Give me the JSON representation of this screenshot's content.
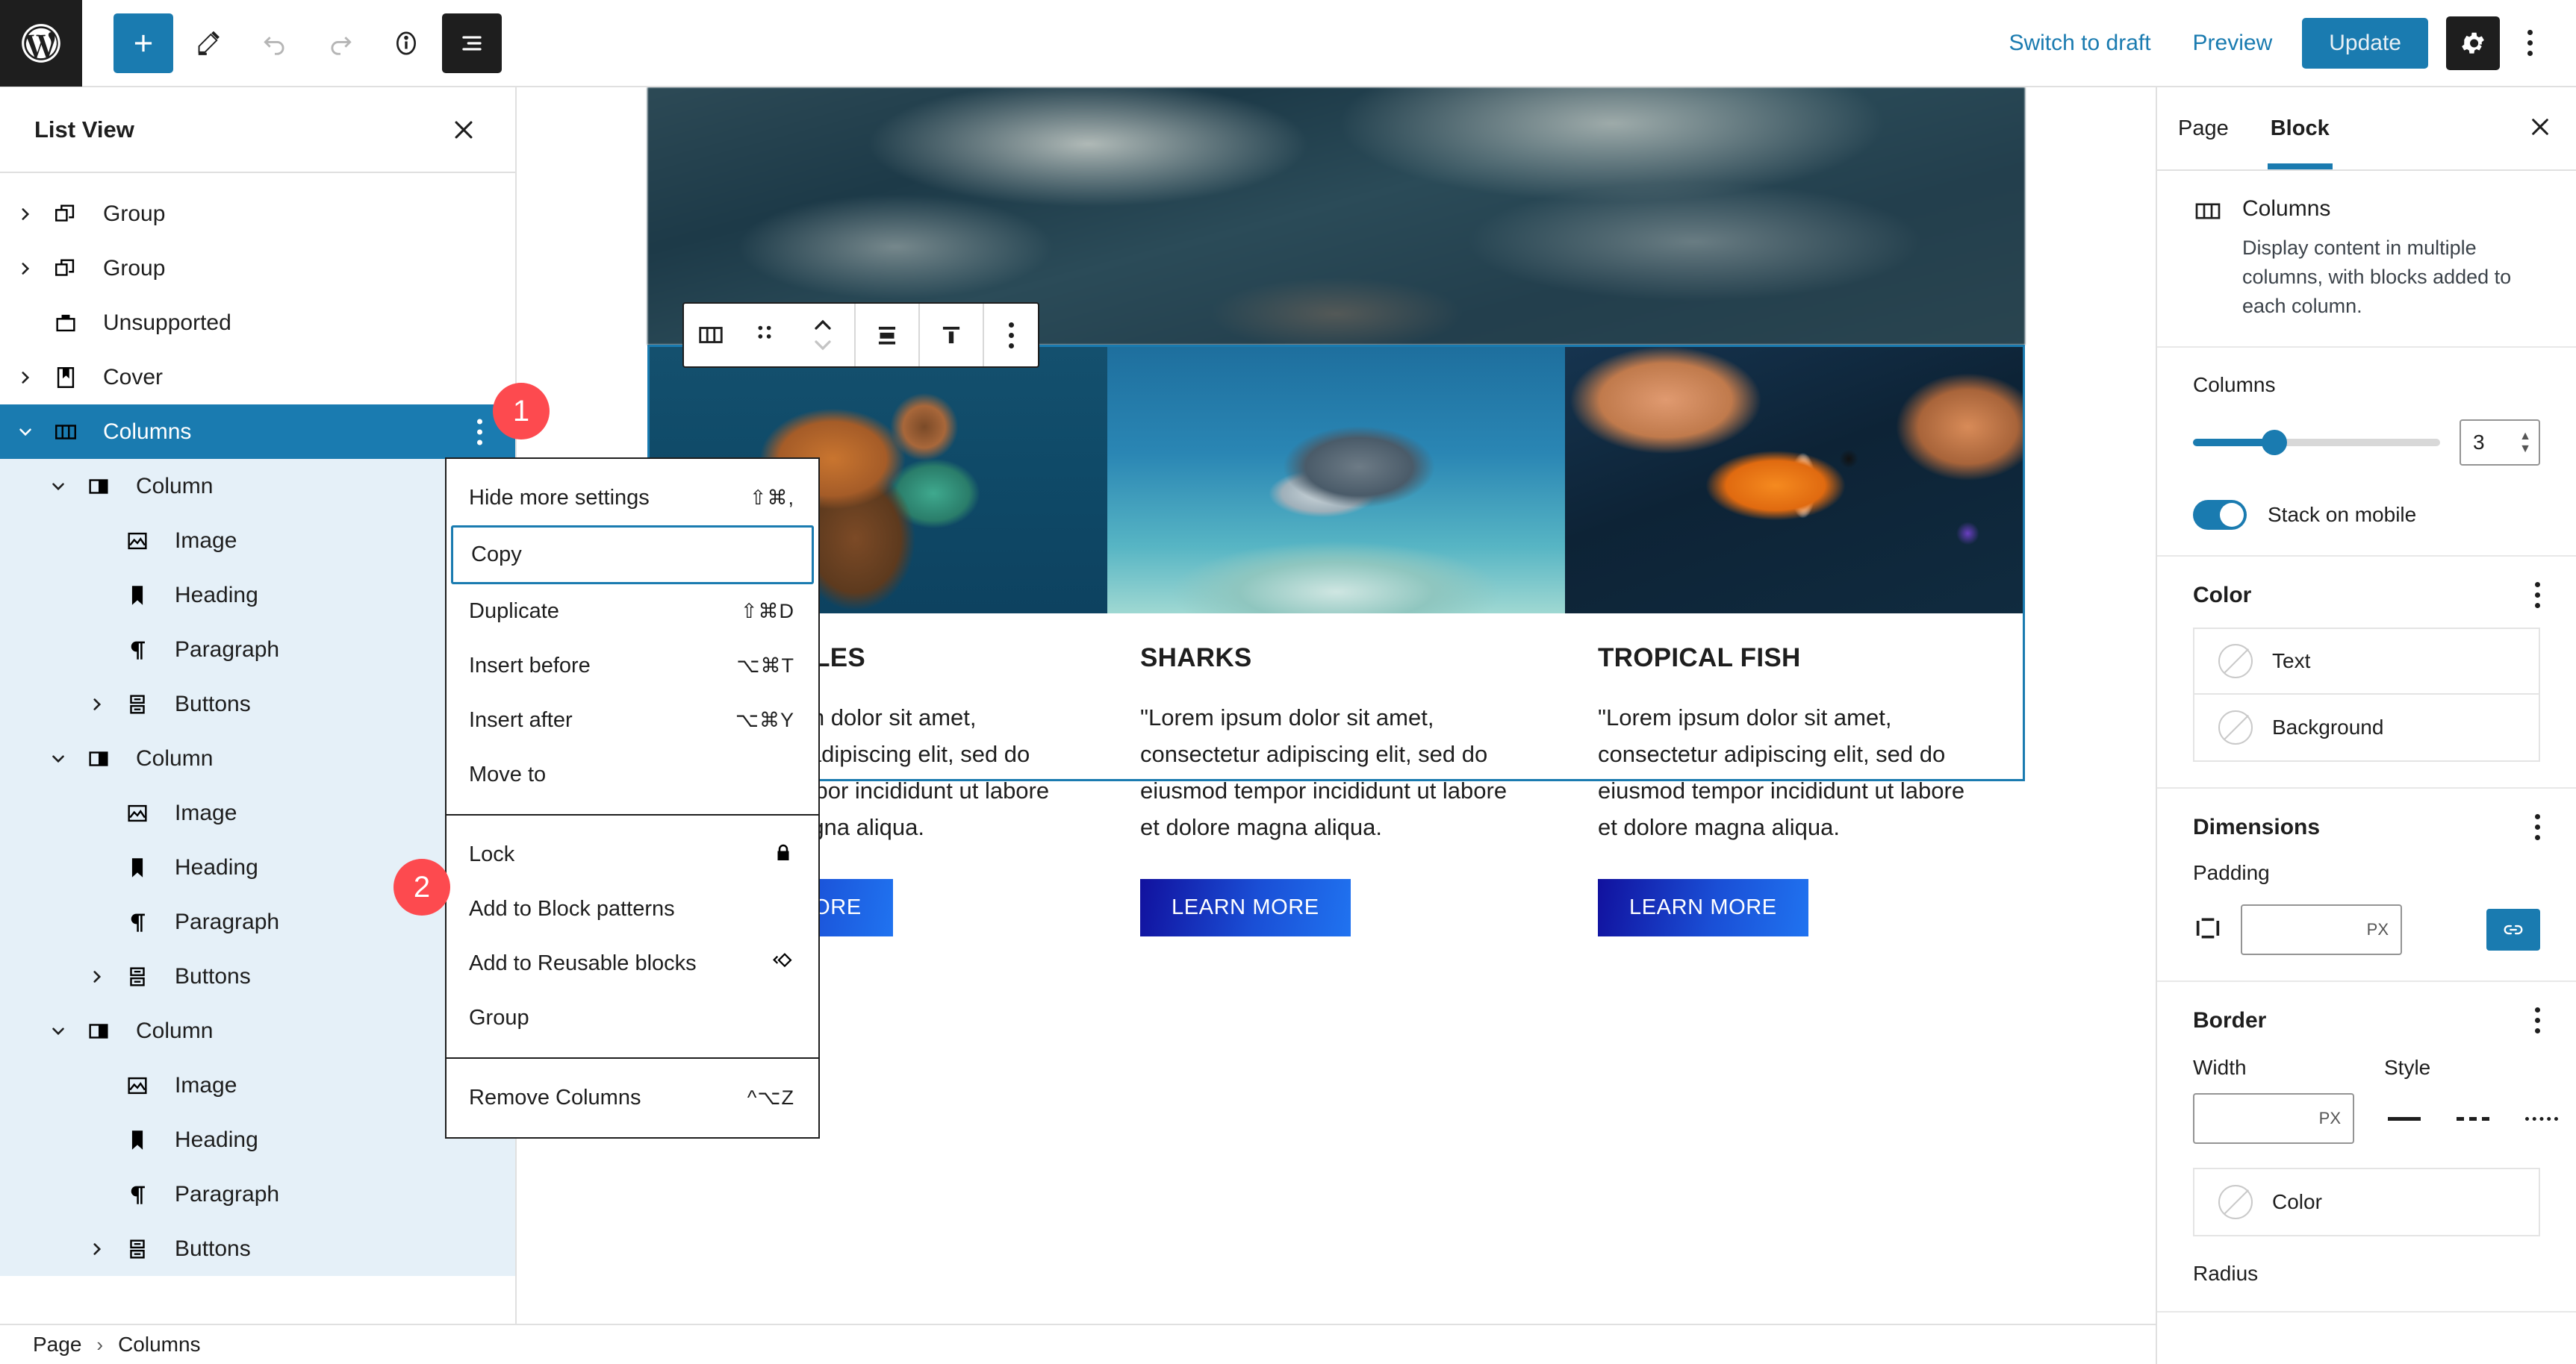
{
  "topbar": {
    "logo_icon": "wordpress-logo-icon",
    "left_buttons": [
      {
        "name": "block-inserter-button",
        "icon": "plus-icon",
        "label": "+"
      },
      {
        "name": "tools-edit-button",
        "icon": "pencil-icon",
        "label": ""
      },
      {
        "name": "undo-button",
        "icon": "undo-arrow-icon",
        "label": ""
      },
      {
        "name": "redo-button",
        "icon": "redo-arrow-icon",
        "label": ""
      },
      {
        "name": "details-button",
        "icon": "info-circle-icon",
        "label": ""
      },
      {
        "name": "list-view-button",
        "icon": "list-view-icon",
        "label": ""
      }
    ],
    "switch_to_draft": "Switch to draft",
    "preview": "Preview",
    "update": "Update",
    "settings_icon": "gear-icon",
    "more_icon": "kebab-menu-icon"
  },
  "list_view": {
    "title": "List View",
    "close_icon": "close-icon",
    "items": [
      {
        "label": "Group",
        "icon": "group-block-icon",
        "depth": 0,
        "chevron": "right",
        "selected": false,
        "highlight": false
      },
      {
        "label": "Group",
        "icon": "group-block-icon",
        "depth": 0,
        "chevron": "right",
        "selected": false,
        "highlight": false
      },
      {
        "label": "Unsupported",
        "icon": "unsupported-block-icon",
        "depth": 0,
        "chevron": "none",
        "selected": false,
        "highlight": false
      },
      {
        "label": "Cover",
        "icon": "cover-block-icon",
        "depth": 0,
        "chevron": "right",
        "selected": false,
        "highlight": false
      },
      {
        "label": "Columns",
        "icon": "columns-block-icon",
        "depth": 0,
        "chevron": "down",
        "selected": true,
        "highlight": false
      },
      {
        "label": "Column",
        "icon": "column-block-icon",
        "depth": 1,
        "chevron": "down",
        "selected": false,
        "highlight": true
      },
      {
        "label": "Image",
        "icon": "image-block-icon",
        "depth": 2,
        "chevron": "none",
        "selected": false,
        "highlight": true
      },
      {
        "label": "Heading",
        "icon": "heading-block-icon",
        "depth": 2,
        "chevron": "none",
        "selected": false,
        "highlight": true
      },
      {
        "label": "Paragraph",
        "icon": "paragraph-block-icon",
        "depth": 2,
        "chevron": "none",
        "selected": false,
        "highlight": true
      },
      {
        "label": "Buttons",
        "icon": "buttons-block-icon",
        "depth": 2,
        "chevron": "right",
        "selected": false,
        "highlight": true
      },
      {
        "label": "Column",
        "icon": "column-block-icon",
        "depth": 1,
        "chevron": "down",
        "selected": false,
        "highlight": true
      },
      {
        "label": "Image",
        "icon": "image-block-icon",
        "depth": 2,
        "chevron": "none",
        "selected": false,
        "highlight": true
      },
      {
        "label": "Heading",
        "icon": "heading-block-icon",
        "depth": 2,
        "chevron": "none",
        "selected": false,
        "highlight": true
      },
      {
        "label": "Paragraph",
        "icon": "paragraph-block-icon",
        "depth": 2,
        "chevron": "none",
        "selected": false,
        "highlight": true
      },
      {
        "label": "Buttons",
        "icon": "buttons-block-icon",
        "depth": 2,
        "chevron": "right",
        "selected": false,
        "highlight": true
      },
      {
        "label": "Column",
        "icon": "column-block-icon",
        "depth": 1,
        "chevron": "down",
        "selected": false,
        "highlight": true
      },
      {
        "label": "Image",
        "icon": "image-block-icon",
        "depth": 2,
        "chevron": "none",
        "selected": false,
        "highlight": true
      },
      {
        "label": "Heading",
        "icon": "heading-block-icon",
        "depth": 2,
        "chevron": "none",
        "selected": false,
        "highlight": true
      },
      {
        "label": "Paragraph",
        "icon": "paragraph-block-icon",
        "depth": 2,
        "chevron": "none",
        "selected": false,
        "highlight": true
      },
      {
        "label": "Buttons",
        "icon": "buttons-block-icon",
        "depth": 2,
        "chevron": "right",
        "selected": false,
        "highlight": true
      }
    ]
  },
  "badges": [
    {
      "number": "1"
    },
    {
      "number": "2"
    }
  ],
  "context_menu": {
    "groups": [
      {
        "items": [
          {
            "label": "Hide more settings",
            "shortcut": "⇧⌘,",
            "focused": false,
            "icon": ""
          },
          {
            "label": "Copy",
            "shortcut": "",
            "focused": true,
            "icon": ""
          },
          {
            "label": "Duplicate",
            "shortcut": "⇧⌘D",
            "focused": false,
            "icon": ""
          },
          {
            "label": "Insert before",
            "shortcut": "⌥⌘T",
            "focused": false,
            "icon": ""
          },
          {
            "label": "Insert after",
            "shortcut": "⌥⌘Y",
            "focused": false,
            "icon": ""
          },
          {
            "label": "Move to",
            "shortcut": "",
            "focused": false,
            "icon": ""
          }
        ]
      },
      {
        "items": [
          {
            "label": "Lock",
            "shortcut": "",
            "focused": false,
            "icon": "lock-icon"
          },
          {
            "label": "Add to Block patterns",
            "shortcut": "",
            "focused": false,
            "icon": ""
          },
          {
            "label": "Add to Reusable blocks",
            "shortcut": "",
            "focused": false,
            "icon": "reusable-block-icon"
          },
          {
            "label": "Group",
            "shortcut": "",
            "focused": false,
            "icon": ""
          }
        ]
      },
      {
        "items": [
          {
            "label": "Remove Columns",
            "shortcut": "^⌥Z",
            "focused": false,
            "icon": ""
          }
        ]
      }
    ]
  },
  "block_toolbar": {
    "items": [
      {
        "name": "block-type-columns-button",
        "icon": "columns-block-icon"
      },
      {
        "name": "drag-handle",
        "icon": "drag-dots-icon"
      },
      {
        "name": "move-up-down-buttons",
        "icon": "chevron-up-down-icon"
      },
      {
        "name": "change-alignment-button",
        "icon": "align-center-icon"
      },
      {
        "name": "vertical-align-button",
        "icon": "vertical-align-top-icon"
      },
      {
        "name": "block-options-button",
        "icon": "kebab-menu-icon"
      }
    ]
  },
  "editor": {
    "cover_block": {
      "alt": "ocean-waves-cover-image"
    },
    "columns": [
      {
        "image_alt": "sea-turtle-image",
        "heading": "SEA TURTLES",
        "paragraph": "\"Lorem ipsum dolor sit amet, consectetur adipiscing elit, sed do eiusmod tempor incididunt ut labore et dolore magna aliqua.",
        "button": "LEARN MORE"
      },
      {
        "image_alt": "shark-image",
        "heading": "SHARKS",
        "paragraph": "\"Lorem ipsum dolor sit amet, consectetur adipiscing elit, sed do eiusmod tempor incididunt ut labore et dolore magna aliqua.",
        "button": "LEARN MORE"
      },
      {
        "image_alt": "clownfish-image",
        "heading": "TROPICAL FISH",
        "paragraph": "\"Lorem ipsum dolor sit amet, consectetur adipiscing elit, sed do eiusmod tempor incididunt ut labore et dolore magna aliqua.",
        "button": "LEARN MORE"
      }
    ]
  },
  "settings_panel": {
    "tabs": [
      {
        "label": "Page",
        "active": false
      },
      {
        "label": "Block",
        "active": true
      }
    ],
    "close_icon": "close-icon",
    "block": {
      "icon": "columns-block-icon",
      "name": "Columns",
      "description": "Display content in multiple columns, with blocks added to each column."
    },
    "columns_control": {
      "label": "Columns",
      "value": "3",
      "slider_fill_percent": 33
    },
    "stack_on_mobile": {
      "label": "Stack on mobile",
      "enabled": true
    },
    "color": {
      "title": "Color",
      "more_icon": "kebab-menu-icon",
      "items": [
        {
          "label": "Text",
          "swatch": "none"
        },
        {
          "label": "Background",
          "swatch": "none"
        }
      ]
    },
    "dimensions": {
      "title": "Dimensions",
      "more_icon": "kebab-menu-icon",
      "padding_label": "Padding",
      "padding_unit": "PX",
      "padding_value": "",
      "link_icon": "link-sides-icon"
    },
    "border": {
      "title": "Border",
      "more_icon": "kebab-menu-icon",
      "width_label": "Width",
      "width_unit": "PX",
      "width_value": "",
      "style_label": "Style",
      "styles": [
        "solid",
        "dashed",
        "dotted"
      ],
      "color_label": "Color",
      "radius_label": "Radius"
    },
    "accent_color": "#1a7bb0"
  },
  "breadcrumb": {
    "items": [
      "Page",
      "Columns"
    ],
    "separator": "›"
  }
}
